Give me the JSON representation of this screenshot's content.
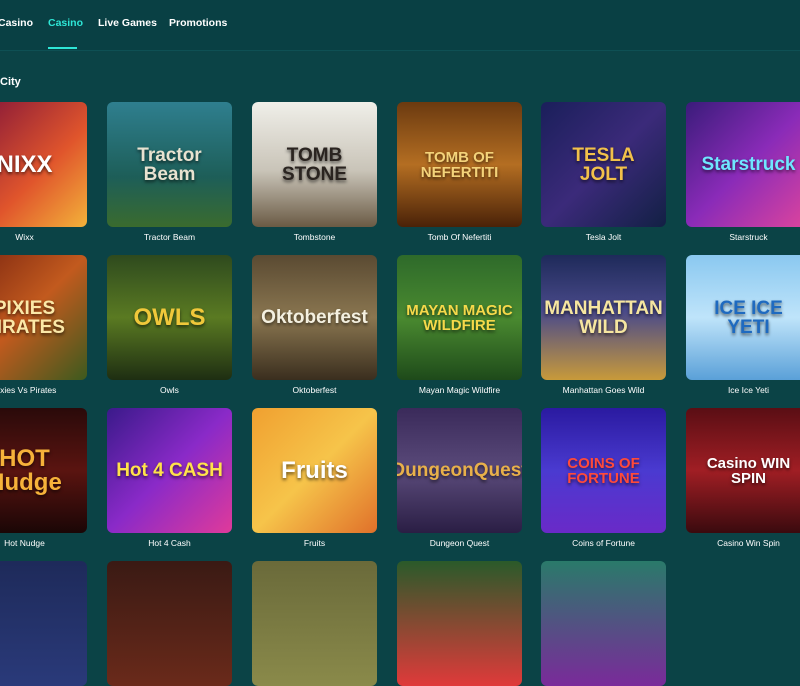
{
  "nav": {
    "tabs": [
      {
        "label": "Casino",
        "active": false
      },
      {
        "label": "Casino",
        "active": true
      },
      {
        "label": "Live Games",
        "active": false
      },
      {
        "label": "Promotions",
        "active": false
      }
    ]
  },
  "section": {
    "title": "City"
  },
  "games": [
    {
      "name": "Wixx",
      "art": "NIXX",
      "bg": "linear-gradient(135deg,#7a0f3a,#e0552c 60%,#f3b23a)",
      "fg": "#ffffff"
    },
    {
      "name": "Tractor Beam",
      "art": "Tractor Beam",
      "bg": "linear-gradient(180deg,#2f7f8f,#1d5e58 60%,#3a6b2e)",
      "fg": "#e8e2d0"
    },
    {
      "name": "Tombstone",
      "art": "TOMB STONE",
      "bg": "linear-gradient(180deg,#f0efe9,#c9c4b8 55%,#6a5a44)",
      "fg": "#2a2420"
    },
    {
      "name": "Tomb Of Nefertiti",
      "art": "TOMB OF NEFERTITI",
      "bg": "linear-gradient(180deg,#6b3a10,#b46e22 50%,#4a2208)",
      "fg": "#f4d37a"
    },
    {
      "name": "Tesla Jolt",
      "art": "TESLA JOLT",
      "bg": "linear-gradient(135deg,#1a1f5a,#3b2a7a 50%,#122044)",
      "fg": "#f2c14a"
    },
    {
      "name": "Starstruck",
      "art": "Starstruck",
      "bg": "linear-gradient(135deg,#3a1c7a,#8a2bb8 50%,#e0459c)",
      "fg": "#6fe6ff"
    },
    {
      "name": "Pixies Vs Pirates",
      "art": "PIXIES PIRATES",
      "bg": "linear-gradient(135deg,#7a2410,#c25a1e 50%,#3c5a1e)",
      "fg": "#fbe8a8"
    },
    {
      "name": "Owls",
      "art": "OWLS",
      "bg": "linear-gradient(180deg,#2e4a1e,#5a7a22 50%,#1e2e12)",
      "fg": "#f0c83a"
    },
    {
      "name": "Oktoberfest",
      "art": "Oktoberfest",
      "bg": "linear-gradient(180deg,#5a4a32,#8a7650 50%,#3a2e1e)",
      "fg": "#f4f0e0"
    },
    {
      "name": "Mayan Magic Wildfire",
      "art": "MAYAN MAGIC WILDFIRE",
      "bg": "linear-gradient(180deg,#2e6a2a,#4a8a30 50%,#1e4a1a)",
      "fg": "#f6d94a"
    },
    {
      "name": "Manhattan Goes Wild",
      "art": "MANHATTAN WILD",
      "bg": "linear-gradient(180deg,#1e2a5a,#4a4a8a 45%,#c89a3a)",
      "fg": "#f6e6a0"
    },
    {
      "name": "Ice Ice Yeti",
      "art": "ICE ICE YETI",
      "bg": "linear-gradient(180deg,#8ac8f0,#bfe4fa 50%,#5aa0d8)",
      "fg": "#1e6ac0"
    },
    {
      "name": "Hot Nudge",
      "art": "HOT Nudge",
      "bg": "linear-gradient(180deg,#2a0a0a,#5a1410 50%,#1a0606)",
      "fg": "#f6b23a"
    },
    {
      "name": "Hot 4 Cash",
      "art": "Hot 4 CASH",
      "bg": "linear-gradient(135deg,#3a1a8a,#8a2ac8 50%,#e03a9a)",
      "fg": "#ffe24a"
    },
    {
      "name": "Fruits",
      "art": "Fruits",
      "bg": "linear-gradient(135deg,#f0a030,#f6c44a 50%,#e0702a)",
      "fg": "#ffffff"
    },
    {
      "name": "Dungeon Quest",
      "art": "DungeonQuest",
      "bg": "linear-gradient(180deg,#3a2a5a,#5a4a7a 50%,#2a1e44)",
      "fg": "#e8b04a"
    },
    {
      "name": "Coins of Fortune",
      "art": "COINS OF FORTUNE",
      "bg": "linear-gradient(180deg,#2a1aa0,#4a3ad0 50%,#6a2ac8)",
      "fg": "#ff4a3a"
    },
    {
      "name": "Casino Win Spin",
      "art": "Casino WIN SPIN",
      "bg": "linear-gradient(180deg,#5a0e14,#a01e24 50%,#3a0a0e)",
      "fg": "#ffffff"
    },
    {
      "name": "",
      "art": "",
      "bg": "linear-gradient(180deg,#1e2a5a,#2a3a7a)",
      "fg": "#ffffff"
    },
    {
      "name": "",
      "art": "",
      "bg": "linear-gradient(180deg,#3a1a14,#6a2a1a)",
      "fg": "#ffffff"
    },
    {
      "name": "",
      "art": "",
      "bg": "linear-gradient(180deg,#6a6a3a,#8a8a4a)",
      "fg": "#ffffff"
    },
    {
      "name": "",
      "art": "",
      "bg": "linear-gradient(180deg,#2a5a2a,#e03a3a)",
      "fg": "#ffffff"
    },
    {
      "name": "",
      "art": "",
      "bg": "linear-gradient(180deg,#2a7a6a,#7a2a9a)",
      "fg": "#ffffff"
    }
  ]
}
